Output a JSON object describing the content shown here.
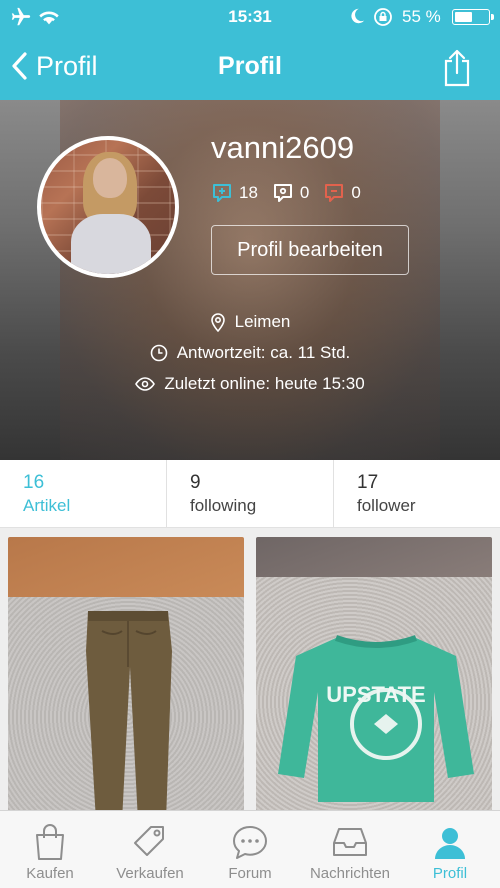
{
  "status_bar": {
    "time": "15:31",
    "battery_text": "55 %",
    "battery_level": 0.55
  },
  "nav": {
    "back_label": "Profil",
    "title": "Profil"
  },
  "profile": {
    "username": "vanni2609",
    "ratings": {
      "positive": "18",
      "neutral": "0",
      "negative": "0"
    },
    "edit_button": "Profil bearbeiten",
    "location": "Leimen",
    "response_time": "Antwortzeit: ca. 11 Std.",
    "last_online": "Zuletzt online: heute 15:30"
  },
  "stats": [
    {
      "count": "16",
      "label": "Artikel"
    },
    {
      "count": "9",
      "label": "following"
    },
    {
      "count": "17",
      "label": "follower"
    }
  ],
  "articles": [
    {
      "icon": "brown-pants-photo"
    },
    {
      "icon": "upstate-sweater-photo"
    }
  ],
  "tabs": [
    {
      "label": "Kaufen",
      "icon": "shopping-bag-icon"
    },
    {
      "label": "Verkaufen",
      "icon": "price-tag-icon"
    },
    {
      "label": "Forum",
      "icon": "chat-bubble-icon"
    },
    {
      "label": "Nachrichten",
      "icon": "inbox-icon"
    },
    {
      "label": "Profil",
      "icon": "profile-icon"
    }
  ],
  "colors": {
    "accent": "#3dbfd6",
    "rating_positive": "#3dbfd6",
    "rating_negative": "#e2624d"
  }
}
